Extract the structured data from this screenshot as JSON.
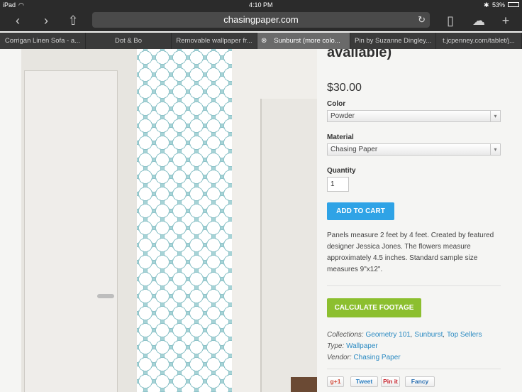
{
  "status_bar": {
    "device": "iPad",
    "time": "4:10 PM",
    "battery": "53%"
  },
  "browser": {
    "url": "chasingpaper.com",
    "tabs": [
      {
        "label": "Corrigan Linen Sofa - a..."
      },
      {
        "label": "Dot & Bo"
      },
      {
        "label": "Removable wallpaper fr..."
      },
      {
        "label": "Sunburst (more colo...",
        "active": true
      },
      {
        "label": "Pin by Suzanne Dingley..."
      },
      {
        "label": "t.jcpenney.com/tablet/j..."
      }
    ]
  },
  "product": {
    "title": "Sunburst (more colors available)",
    "price": "$30.00",
    "color_label": "Color",
    "color_value": "Powder",
    "material_label": "Material",
    "material_value": "Chasing Paper",
    "quantity_label": "Quantity",
    "quantity_value": "1",
    "add_to_cart": "ADD TO CART",
    "description": "Panels measure 2 feet by 4 feet.  Created by featured designer Jessica Jones.  The flowers measure approximately 4.5 inches.  Standard sample size measures 9\"x12\".",
    "calculate": "CALCULATE FOOTAGE",
    "collections_label": "Collections:",
    "collections": [
      "Geometry 101",
      "Sunburst",
      "Top Sellers"
    ],
    "type_label": "Type:",
    "type_value": "Wallpaper",
    "vendor_label": "Vendor:",
    "vendor_value": "Chasing Paper"
  },
  "share": {
    "gplus": "g+1",
    "tweet": "Tweet",
    "pinit": "Pin it",
    "fancy": "Fancy"
  },
  "colors": {
    "cart": "#2fa3e6",
    "calc": "#8cbf2f",
    "link": "#2a8ac2"
  }
}
